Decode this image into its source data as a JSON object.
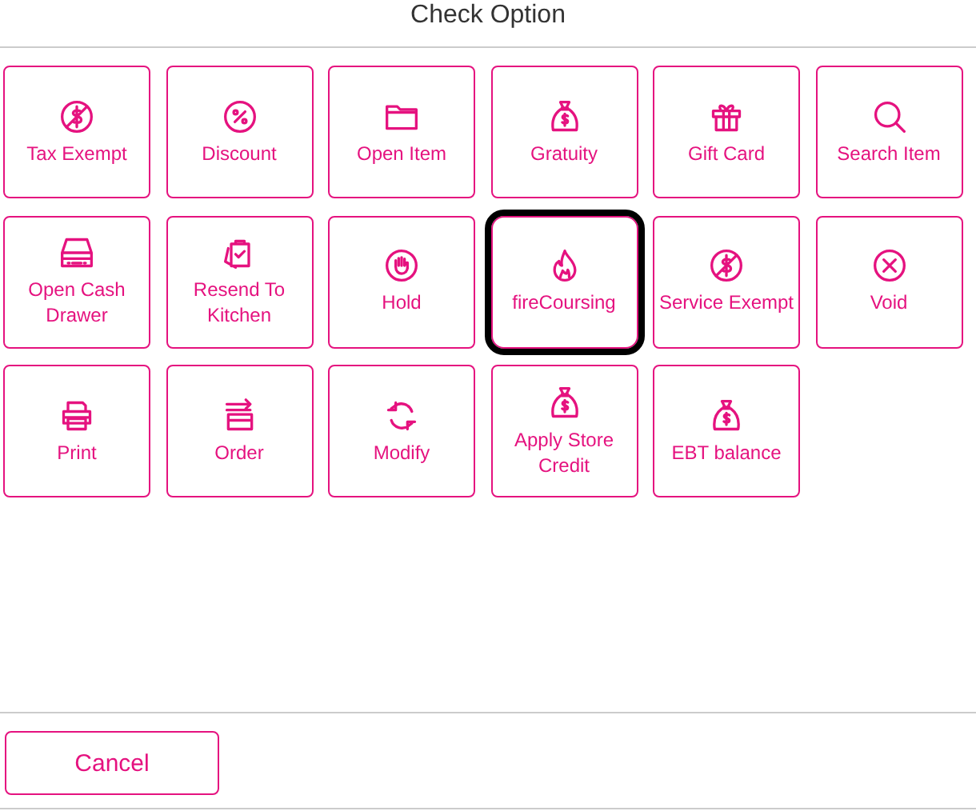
{
  "title": "Check Option",
  "options": [
    {
      "label": "Tax Exempt",
      "focused": false
    },
    {
      "label": "Discount",
      "focused": false
    },
    {
      "label": "Open Item",
      "focused": false
    },
    {
      "label": "Gratuity",
      "focused": false
    },
    {
      "label": "Gift Card",
      "focused": false
    },
    {
      "label": "Search Item",
      "focused": false
    },
    {
      "label": "Open Cash Drawer",
      "focused": false
    },
    {
      "label": "Resend To Kitchen",
      "focused": false
    },
    {
      "label": "Hold",
      "focused": false
    },
    {
      "label": "fireCoursing",
      "focused": true
    },
    {
      "label": "Service Exempt",
      "focused": false
    },
    {
      "label": "Void",
      "focused": false
    },
    {
      "label": "Print",
      "focused": false
    },
    {
      "label": "Order",
      "focused": false
    },
    {
      "label": "Modify",
      "focused": false
    },
    {
      "label": "Apply Store Credit",
      "focused": false
    },
    {
      "label": "EBT balance",
      "focused": false
    }
  ],
  "cancel": "Cancel"
}
